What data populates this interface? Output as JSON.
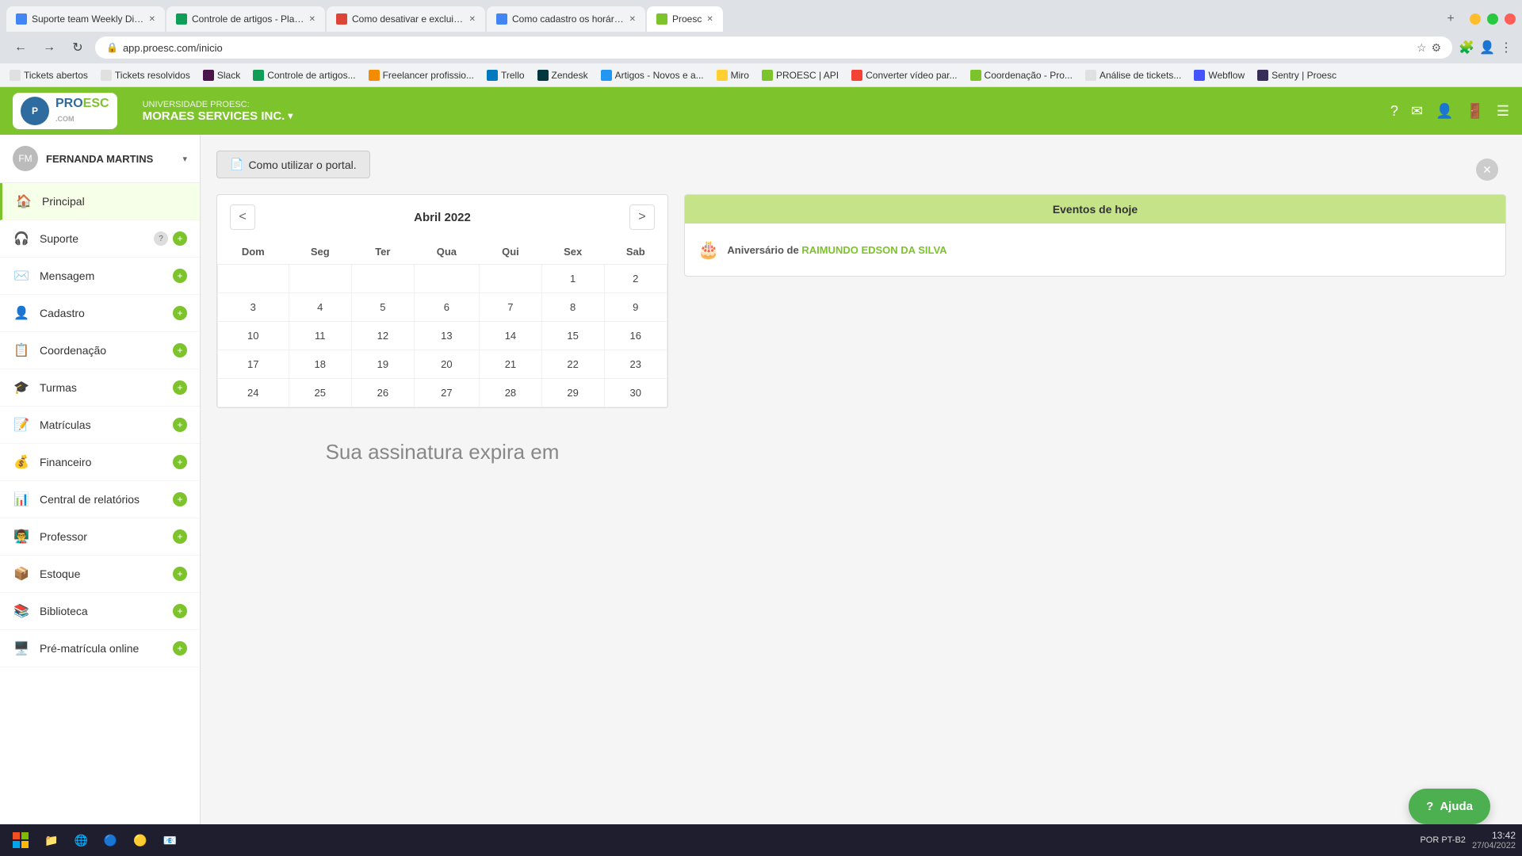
{
  "browser": {
    "tabs": [
      {
        "id": "tab1",
        "label": "Suporte team Weekly Digest - j...",
        "favicon_color": "#4285f4",
        "active": false
      },
      {
        "id": "tab2",
        "label": "Controle de artigos - Planilhas G...",
        "favicon_color": "#0f9d58",
        "active": false
      },
      {
        "id": "tab3",
        "label": "Como desativar e excluir um us...",
        "favicon_color": "#db4437",
        "active": false
      },
      {
        "id": "tab4",
        "label": "Como cadastro os horários de u...",
        "favicon_color": "#4285f4",
        "active": false
      },
      {
        "id": "tab5",
        "label": "Proesc",
        "favicon_color": "#7dc32b",
        "active": true
      }
    ],
    "url": "app.proesc.com/inicio",
    "bookmarks": [
      {
        "label": "Tickets abertos",
        "favicon_color": "#e0e0e0"
      },
      {
        "label": "Tickets resolvidos",
        "favicon_color": "#e0e0e0"
      },
      {
        "label": "Slack",
        "favicon_color": "#4a154b"
      },
      {
        "label": "Controle de artigos...",
        "favicon_color": "#0f9d58"
      },
      {
        "label": "Freelancer profissio...",
        "favicon_color": "#f38c00"
      },
      {
        "label": "Trello",
        "favicon_color": "#0079bf"
      },
      {
        "label": "Zendesk",
        "favicon_color": "#03363d"
      },
      {
        "label": "Artigos - Novos e a...",
        "favicon_color": "#2196f3"
      },
      {
        "label": "Miro",
        "favicon_color": "#ffd02f"
      },
      {
        "label": "PROESC | API",
        "favicon_color": "#7dc32b"
      },
      {
        "label": "Converter vídeo par...",
        "favicon_color": "#f44336"
      },
      {
        "label": "Coordenação - Pro...",
        "favicon_color": "#7dc32b"
      },
      {
        "label": "Análise de tickets...",
        "favicon_color": "#e0e0e0"
      },
      {
        "label": "Webflow",
        "favicon_color": "#4353ff"
      },
      {
        "label": "Sentry | Proesc",
        "favicon_color": "#362d59"
      }
    ]
  },
  "header": {
    "university_label": "UNIVERSIDADE PROESC:",
    "university_name": "MORAES SERVICES INC.",
    "logo_text": "PROESC",
    "icons": [
      "help",
      "mail",
      "person",
      "exit",
      "menu"
    ]
  },
  "sidebar": {
    "user_name": "FERNANDA MARTINS",
    "items": [
      {
        "id": "principal",
        "label": "Principal",
        "icon": "🏠",
        "active": true
      },
      {
        "id": "suporte",
        "label": "Suporte",
        "icon": "🎧",
        "has_help": true,
        "has_plus": true
      },
      {
        "id": "mensagem",
        "label": "Mensagem",
        "icon": "✉️",
        "has_plus": true
      },
      {
        "id": "cadastro",
        "label": "Cadastro",
        "icon": "👤",
        "has_plus": true
      },
      {
        "id": "coordenacao",
        "label": "Coordenação",
        "icon": "📋",
        "has_plus": true
      },
      {
        "id": "turmas",
        "label": "Turmas",
        "icon": "🎓",
        "has_plus": true
      },
      {
        "id": "matriculas",
        "label": "Matrículas",
        "icon": "📝",
        "has_plus": true
      },
      {
        "id": "financeiro",
        "label": "Financeiro",
        "icon": "💰",
        "has_plus": true
      },
      {
        "id": "central-relatorios",
        "label": "Central de relatórios",
        "icon": "📊",
        "has_plus": true
      },
      {
        "id": "professor",
        "label": "Professor",
        "icon": "👨‍🏫",
        "has_plus": true
      },
      {
        "id": "estoque",
        "label": "Estoque",
        "icon": "📦",
        "has_plus": true
      },
      {
        "id": "biblioteca",
        "label": "Biblioteca",
        "icon": "📚",
        "has_plus": true
      },
      {
        "id": "pre-matricula",
        "label": "Pré-matrícula online",
        "icon": "🖥️",
        "has_plus": true
      }
    ]
  },
  "portal_button": {
    "label": "Como utilizar o portal.",
    "icon": "📄"
  },
  "calendar": {
    "title": "Abril 2022",
    "prev_label": "<",
    "next_label": ">",
    "days": [
      "Dom",
      "Seg",
      "Ter",
      "Qua",
      "Qui",
      "Sex",
      "Sab"
    ],
    "weeks": [
      [
        "",
        "",
        "",
        "",
        "",
        "1",
        "2"
      ],
      [
        "3",
        "4",
        "5",
        "6",
        "7",
        "8",
        "9"
      ],
      [
        "10",
        "11",
        "12",
        "13",
        "14",
        "15",
        "16"
      ],
      [
        "17",
        "18",
        "19",
        "20",
        "21",
        "22",
        "23"
      ],
      [
        "24",
        "25",
        "26",
        "27",
        "28",
        "29",
        "30"
      ]
    ]
  },
  "events": {
    "header": "Eventos de hoje",
    "items": [
      {
        "icon": "🎂",
        "text_prefix": "Aniversário de ",
        "name": "RAIMUNDO EDSON DA SILVA"
      }
    ]
  },
  "subscription": {
    "text": "Sua assinatura expira em"
  },
  "help_button": {
    "label": "Ajuda",
    "icon": "?"
  },
  "taskbar": {
    "time": "13:42",
    "date": "27/04/2022",
    "locale": "POR PT-B2"
  }
}
